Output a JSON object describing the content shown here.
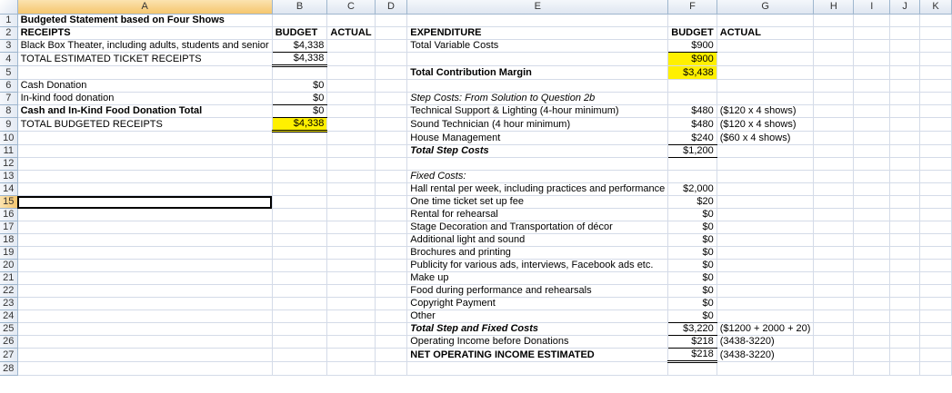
{
  "columns": [
    "A",
    "B",
    "C",
    "D",
    "E",
    "F",
    "G",
    "H",
    "I",
    "J",
    "K"
  ],
  "selected_cell": "A15",
  "highlight_color": "#fff000",
  "rows": [
    {
      "n": "1",
      "cells": {
        "A": "Budgeted Statement based on Four Shows"
      },
      "fmt": {
        "A": "b"
      }
    },
    {
      "n": "2",
      "cells": {
        "A": "RECEIPTS",
        "B": "BUDGET",
        "C": "ACTUAL",
        "E": "EXPENDITURE",
        "F": "BUDGET",
        "G": "ACTUAL"
      },
      "fmt": {
        "A": "b",
        "B": "b",
        "C": "b",
        "E": "b",
        "F": "b",
        "G": "b"
      }
    },
    {
      "n": "3",
      "cells": {
        "A": "Black Box Theater, including adults, students and senior",
        "B": "$4,338",
        "E": "Total Variable Costs",
        "F": "$900"
      },
      "fmt": {
        "B": "r bt",
        "F": "r bt"
      }
    },
    {
      "n": "4",
      "cells": {
        "A": "TOTAL ESTIMATED TICKET RECEIPTS",
        "B": "$4,338",
        "F": "$900"
      },
      "fmt": {
        "B": "r bd",
        "F": "r hl"
      }
    },
    {
      "n": "5",
      "cells": {
        "E": "Total Contribution Margin",
        "F": "$3,438"
      },
      "fmt": {
        "E": "b",
        "F": "r hl"
      }
    },
    {
      "n": "6",
      "cells": {
        "A": "Cash Donation",
        "B": "$0"
      },
      "fmt": {
        "B": "r"
      }
    },
    {
      "n": "7",
      "cells": {
        "A": "In-kind food donation",
        "B": "$0",
        "E": "Step Costs:  From Solution to Question 2b"
      },
      "fmt": {
        "B": "r bt",
        "E": "i"
      }
    },
    {
      "n": "8",
      "cells": {
        "A": "Cash and In-Kind Food Donation Total",
        "B": "$0",
        "E": "Technical Support & Lighting (4-hour minimum)",
        "F": "$480",
        "G": "($120 x 4 shows)"
      },
      "fmt": {
        "A": "b",
        "B": "r bt",
        "F": "r"
      }
    },
    {
      "n": "9",
      "cells": {
        "A": "TOTAL BUDGETED RECEIPTS",
        "B": "$4,338",
        "E": "Sound Technician (4 hour minimum)",
        "F": "$480",
        "G": "($120 x 4 shows)"
      },
      "fmt": {
        "B": "r hl bd",
        "F": "r"
      }
    },
    {
      "n": "10",
      "cells": {
        "E": "House Management",
        "F": "$240",
        "G": "($60 x 4 shows)"
      },
      "fmt": {
        "F": "r bt"
      }
    },
    {
      "n": "11",
      "cells": {
        "E": "Total Step Costs",
        "F": "$1,200"
      },
      "fmt": {
        "E": "b i",
        "F": "r bt"
      }
    },
    {
      "n": "12",
      "cells": {},
      "fmt": {}
    },
    {
      "n": "13",
      "cells": {
        "E": "Fixed Costs:"
      },
      "fmt": {
        "E": "i"
      }
    },
    {
      "n": "14",
      "cells": {
        "E": "Hall rental per week, including practices and performance",
        "F": "$2,000"
      },
      "fmt": {
        "F": "r"
      }
    },
    {
      "n": "15",
      "cells": {
        "E": "One time ticket set up fee",
        "F": "$20"
      },
      "fmt": {
        "F": "r"
      }
    },
    {
      "n": "16",
      "cells": {
        "E": "Rental for rehearsal",
        "F": "$0"
      },
      "fmt": {
        "F": "r"
      }
    },
    {
      "n": "17",
      "cells": {
        "E": "Stage Decoration and Transportation of décor",
        "F": "$0"
      },
      "fmt": {
        "F": "r"
      }
    },
    {
      "n": "18",
      "cells": {
        "E": "Additional light and sound",
        "F": "$0"
      },
      "fmt": {
        "F": "r"
      }
    },
    {
      "n": "19",
      "cells": {
        "E": "Brochures and printing",
        "F": "$0"
      },
      "fmt": {
        "F": "r"
      }
    },
    {
      "n": "20",
      "cells": {
        "E": "Publicity for various ads, interviews, Facebook ads etc.",
        "F": "$0"
      },
      "fmt": {
        "F": "r"
      }
    },
    {
      "n": "21",
      "cells": {
        "E": "Make up",
        "F": "$0"
      },
      "fmt": {
        "F": "r"
      }
    },
    {
      "n": "22",
      "cells": {
        "E": "Food during performance and rehearsals",
        "F": "$0"
      },
      "fmt": {
        "F": "r"
      }
    },
    {
      "n": "23",
      "cells": {
        "E": "Copyright Payment",
        "F": "$0"
      },
      "fmt": {
        "F": "r"
      }
    },
    {
      "n": "24",
      "cells": {
        "E": "Other",
        "F": "$0"
      },
      "fmt": {
        "F": "r bt"
      }
    },
    {
      "n": "25",
      "cells": {
        "E": "Total Step and Fixed Costs",
        "F": "$3,220",
        "G": "($1200 + 2000 + 20)"
      },
      "fmt": {
        "E": "b i",
        "F": "r bt"
      }
    },
    {
      "n": "26",
      "cells": {
        "E": "Operating Income before Donations",
        "F": "$218",
        "G": "(3438-3220)"
      },
      "fmt": {
        "F": "r bt"
      }
    },
    {
      "n": "27",
      "cells": {
        "E": "NET OPERATING INCOME ESTIMATED",
        "F": "$218",
        "G": "(3438-3220)"
      },
      "fmt": {
        "E": "b",
        "F": "r bd"
      }
    },
    {
      "n": "28",
      "cells": {},
      "fmt": {}
    }
  ]
}
